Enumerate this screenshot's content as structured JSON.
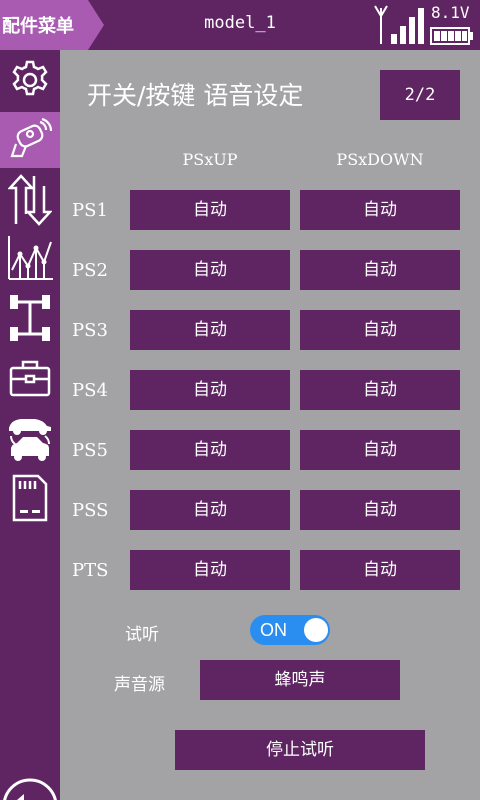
{
  "header": {
    "menu_label": "配件菜单",
    "model_name": "model_1",
    "voltage": "8.1V",
    "signal_bars": 4,
    "battery_level": 1.0
  },
  "sidebar": {
    "items": [
      {
        "icon": "gear-icon"
      },
      {
        "icon": "transmitter-icon",
        "active": true
      },
      {
        "icon": "reverse-arrows-icon"
      },
      {
        "icon": "curve-chart-icon"
      },
      {
        "icon": "chassis-icon"
      },
      {
        "icon": "toolbox-icon"
      },
      {
        "icon": "model-swap-icon"
      },
      {
        "icon": "sd-card-icon"
      }
    ],
    "back_icon": "back-arrow-icon"
  },
  "main": {
    "title": "开关/按键 语音设定",
    "page_indicator": "2/2",
    "columns": [
      "PSxUP",
      "PSxDOWN"
    ],
    "rows": [
      {
        "label": "PS1",
        "up": "自动",
        "down": "自动"
      },
      {
        "label": "PS2",
        "up": "自动",
        "down": "自动"
      },
      {
        "label": "PS3",
        "up": "自动",
        "down": "自动"
      },
      {
        "label": "PS4",
        "up": "自动",
        "down": "自动"
      },
      {
        "label": "PS5",
        "up": "自动",
        "down": "自动"
      },
      {
        "label": "PSS",
        "up": "自动",
        "down": "自动"
      },
      {
        "label": "PTS",
        "up": "自动",
        "down": "自动"
      }
    ],
    "preview_label": "试听",
    "preview_toggle": "ON",
    "sound_source_label": "声音源",
    "sound_source_value": "蜂鸣声",
    "stop_preview_label": "停止试听"
  },
  "colors": {
    "panel": "#5e2562",
    "accent": "#a85bb0",
    "background": "#a3a2a4",
    "toggle_on": "#2a8ef0"
  }
}
